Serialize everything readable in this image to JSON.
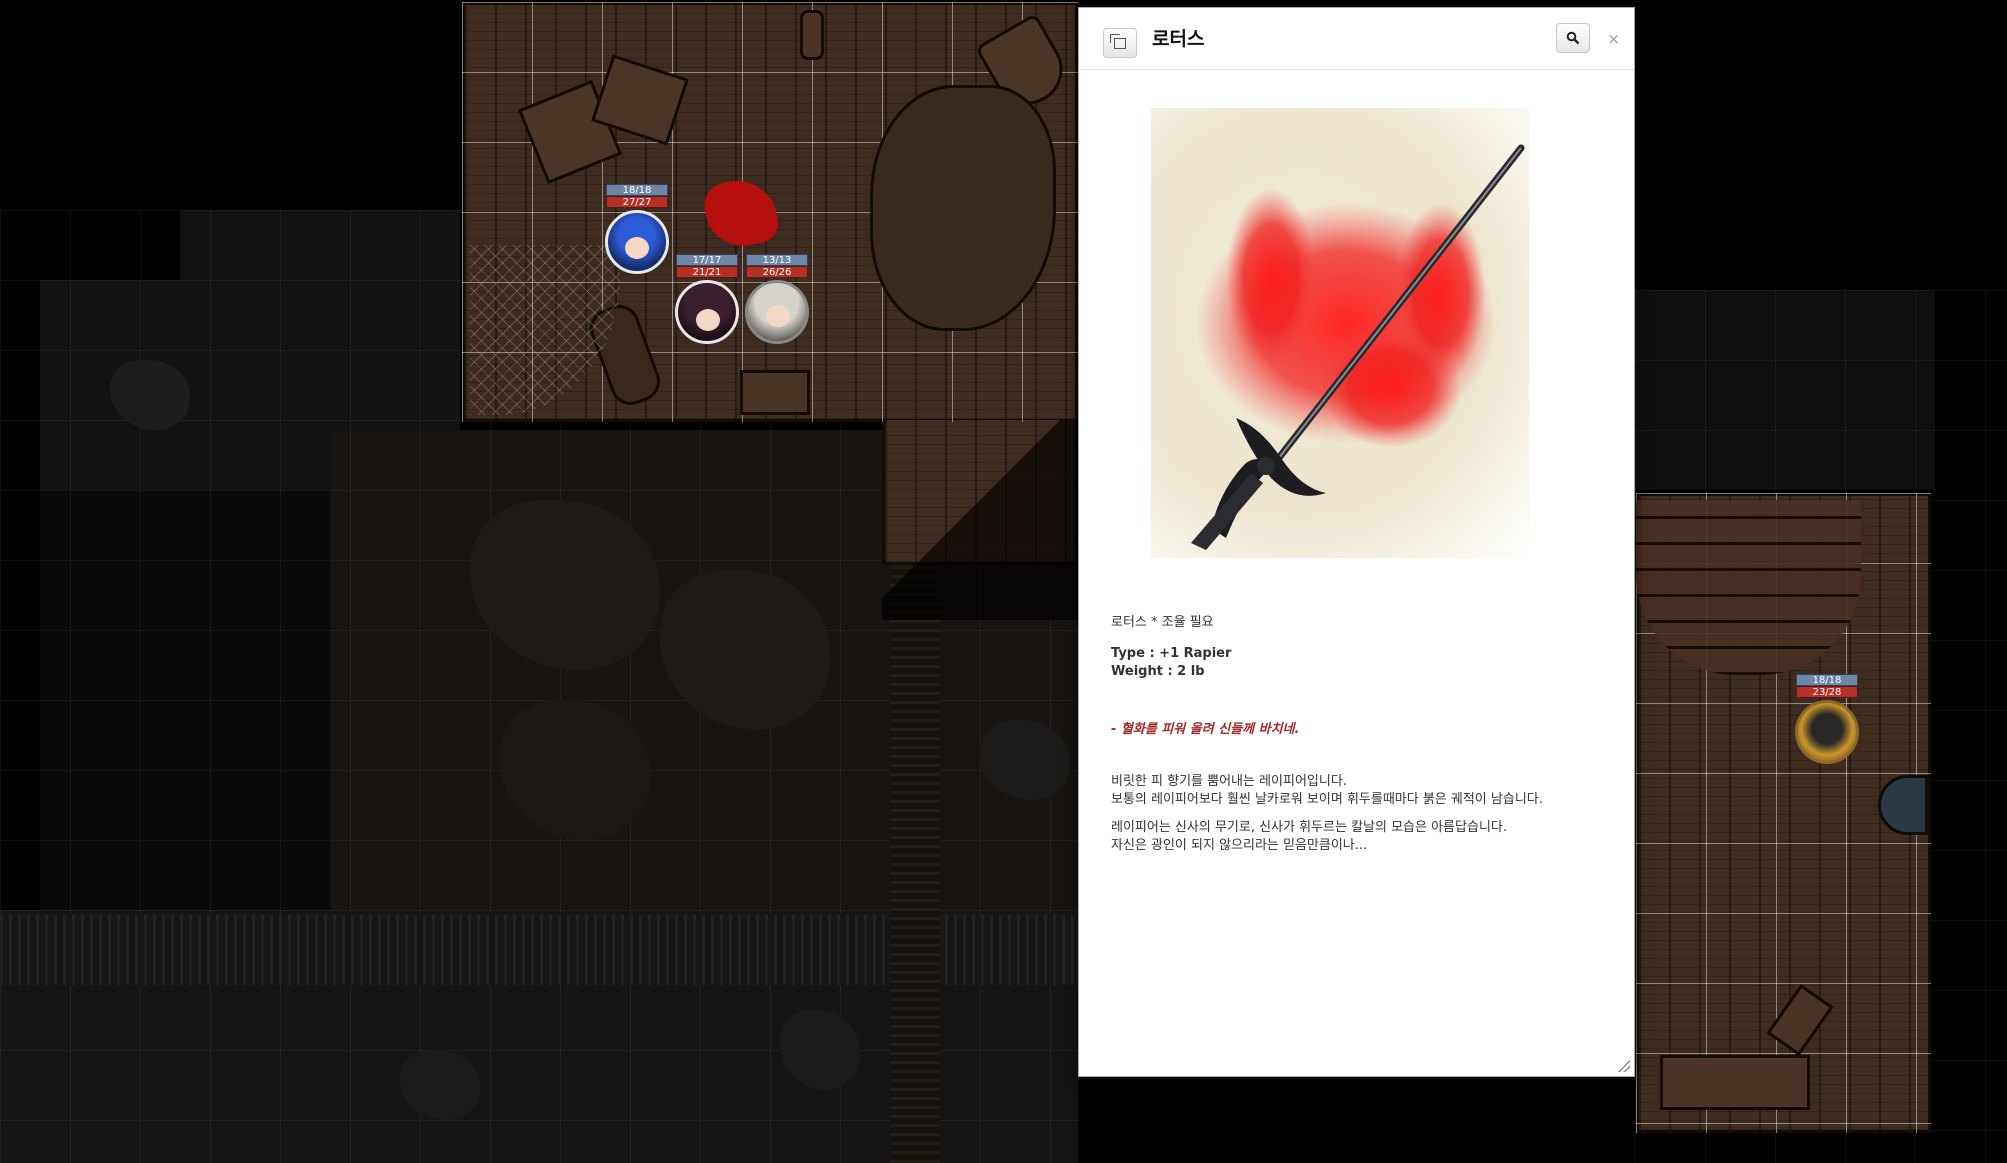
{
  "tokens": [
    {
      "hp": "18/18",
      "sub": "27/27"
    },
    {
      "hp": "17/17",
      "sub": "21/21"
    },
    {
      "hp": "13/13",
      "sub": "26/26"
    },
    {
      "hp": "18/18",
      "sub": "23/28"
    }
  ],
  "dialog": {
    "title": "로터스",
    "popout_icon": "popout-icon",
    "search_icon": "search-icon",
    "close_label": "×",
    "image_name": "rapier-artwork",
    "line1": "로터스 * 조율 필요",
    "type_line": "Type : +1  Rapier",
    "weight_line": "Weight : 2 lb",
    "flavor": "- 혈화를 피워 올려 신들께 바치네.",
    "para1_l1": "비릿한 피 향기를 뿜어내는 레이피어입니다.",
    "para1_l2": "보통의 레이피어보다 훨씬 날카로워 보이며 휘두를때마다 붉은 궤적이 남습니다.",
    "para2_l1": "레이피어는 신사의 무기로, 신사가 휘두르는 칼날의 모습은 아름답습니다.",
    "para2_l2": "자신은 광인이 되지 않으리라는 믿음만큼이나..."
  },
  "colors": {
    "hp_bar": "#6e86a8",
    "sub_bar": "#b43128",
    "blood": "#b50f0f",
    "flavor_text": "#a52a2a"
  }
}
